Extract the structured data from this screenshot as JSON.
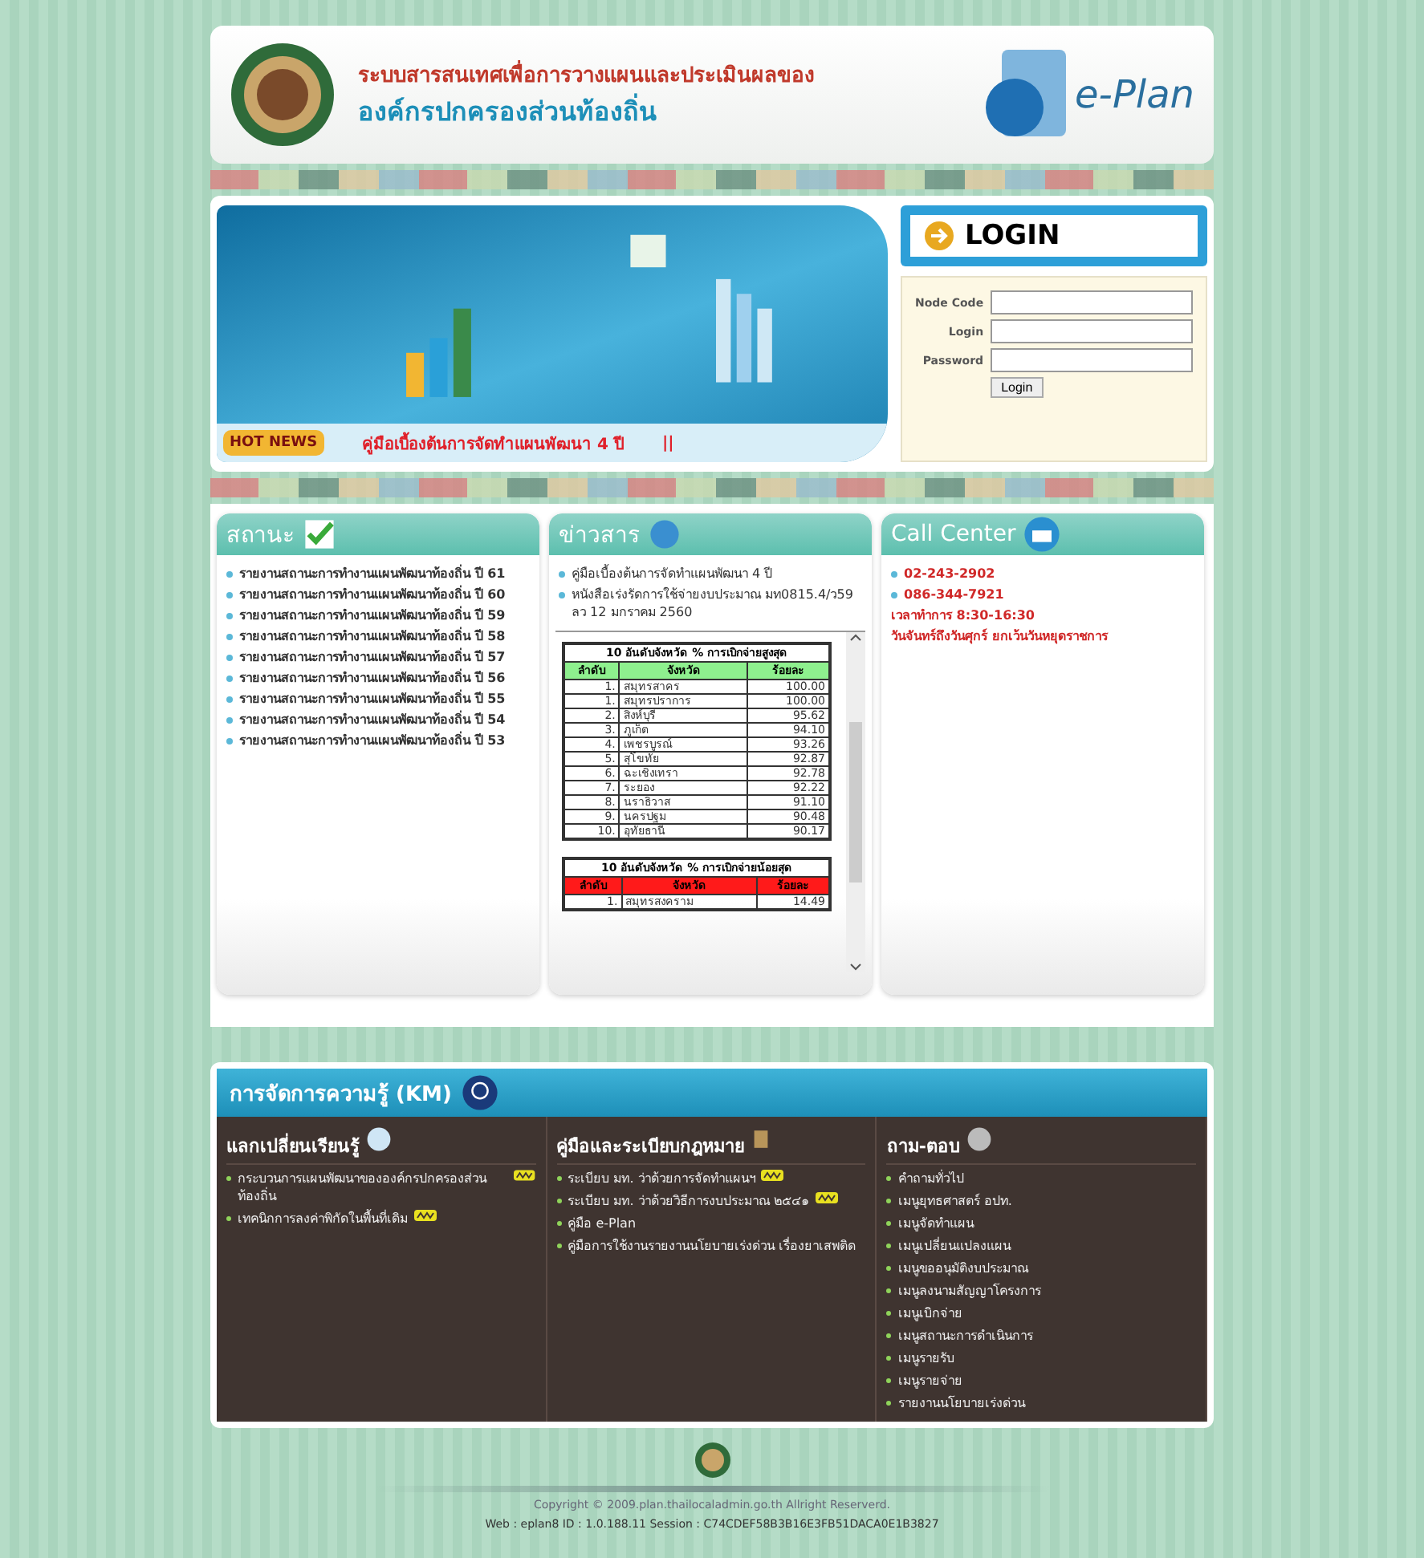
{
  "header": {
    "title_line1": "ระบบสารสนเทศเพื่อการวางแผนและประเมินผลของ",
    "title_line2": "องค์กรปกครองส่วนท้องถิ่น",
    "logo_text": "e-Plan"
  },
  "hot_news": {
    "badge": "HOT NEWS",
    "text": "คู่มือเบื้องต้นการจัดทำแผนพัฒนา 4 ปี",
    "separator": "||"
  },
  "login": {
    "title": "LOGIN",
    "fields": [
      {
        "label": "Node Code"
      },
      {
        "label": "Login"
      },
      {
        "label": "Password"
      }
    ],
    "button": "Login"
  },
  "status_panel": {
    "title": "สถานะ",
    "items": [
      {
        "text": "รายงานสถานะการทำงานแผนพัฒนาท้องถิ่น ปี 61"
      },
      {
        "text": "รายงานสถานะการทำงานแผนพัฒนาท้องถิ่น ปี 60"
      },
      {
        "text": "รายงานสถานะการทำงานแผนพัฒนาท้องถิ่น ปี 59"
      },
      {
        "text": "รายงานสถานะการทำงานแผนพัฒนาท้องถิ่น ปี 58"
      },
      {
        "text": "รายงานสถานะการทำงานแผนพัฒนาท้องถิ่น ปี 57"
      },
      {
        "text": "รายงานสถานะการทำงานแผนพัฒนาท้องถิ่น ปี 56"
      },
      {
        "text": "รายงานสถานะการทำงานแผนพัฒนาท้องถิ่น ปี 55"
      },
      {
        "text": "รายงานสถานะการทำงานแผนพัฒนาท้องถิ่น ปี 54"
      },
      {
        "text": "รายงานสถานะการทำงานแผนพัฒนาท้องถิ่น ปี 53"
      }
    ]
  },
  "news_panel": {
    "title": "ข่าวสาร",
    "items": [
      {
        "text": "คู่มือเบื้องต้นการจัดทำแผนพัฒนา 4 ปี"
      },
      {
        "text": "หนังสือเร่งรัดการใช้จ่ายงบประมาณ มท0815.4/ว59 ลว 12 มกราคม 2560"
      }
    ],
    "tables": [
      {
        "kind": "top",
        "title": "10 อันดับจังหวัด % การเบิกจ่ายสูงสุด",
        "columns": [
          "ลำดับ",
          "จังหวัด",
          "ร้อยละ"
        ],
        "rows": [
          [
            "1.",
            "สมุทรสาคร",
            "100.00"
          ],
          [
            "1.",
            "สมุทรปราการ",
            "100.00"
          ],
          [
            "2.",
            "สิงห์บุรี",
            "95.62"
          ],
          [
            "3.",
            "ภูเก็ต",
            "94.10"
          ],
          [
            "4.",
            "เพชรบูรณ์",
            "93.26"
          ],
          [
            "5.",
            "สุโขทัย",
            "92.87"
          ],
          [
            "6.",
            "ฉะเชิงเทรา",
            "92.78"
          ],
          [
            "7.",
            "ระยอง",
            "92.22"
          ],
          [
            "8.",
            "นราธิวาส",
            "91.10"
          ],
          [
            "9.",
            "นครปฐม",
            "90.48"
          ],
          [
            "10.",
            "อุทัยธานี",
            "90.17"
          ]
        ]
      },
      {
        "kind": "bottom",
        "title": "10 อันดับจังหวัด % การเบิกจ่ายน้อยสุด",
        "columns": [
          "ลำดับ",
          "จังหวัด",
          "ร้อยละ"
        ],
        "rows": [
          [
            "1.",
            "สมุทรสงคราม",
            "14.49"
          ]
        ]
      }
    ]
  },
  "call_center": {
    "title": "Call Center",
    "phones": [
      "02-243-2902",
      "086-344-7921"
    ],
    "hours": "เวลาทำการ 8:30-16:30",
    "days": "วันจันทร์ถึงวันศุกร์ ยกเว้นวันหยุดราชการ"
  },
  "km": {
    "title": "การจัดการความรู้ (KM)",
    "sections": [
      {
        "kind": "exchange",
        "title": "แลกเปลี่ยนเรียนรู้",
        "items": [
          {
            "text": "กระบวนการแผนพัฒนาขององค์กรปกครองส่วนท้องถิ่น",
            "is_new": true
          },
          {
            "text": "เทคนิกการลงค่าพิกัดในพื้นที่เดิม",
            "is_new": true
          }
        ]
      },
      {
        "kind": "manual",
        "title": "คู่มือและระเบียบกฎหมาย",
        "items": [
          {
            "text": "ระเบียบ มท. ว่าด้วยการจัดทำแผนฯ",
            "is_new": true
          },
          {
            "text": "ระเบียบ มท. ว่าด้วยวิธีการงบประมาณ ๒๕๔๑",
            "is_new": true
          },
          {
            "text": "คู่มือ e-Plan",
            "is_new": false
          },
          {
            "text": "คู่มือการใช้งานรายงานนโยบายเร่งด่วน เรื่องยาเสพติด",
            "is_new": false
          }
        ]
      },
      {
        "kind": "faq",
        "title": "ถาม-ตอบ",
        "items": [
          {
            "text": "คำถามทั่วไป",
            "is_new": false
          },
          {
            "text": "เมนูยุทธศาสตร์ อปท.",
            "is_new": false
          },
          {
            "text": "เมนูจัดทำแผน",
            "is_new": false
          },
          {
            "text": "เมนูเปลี่ยนแปลงแผน",
            "is_new": false
          },
          {
            "text": "เมนูขออนุมัติงบประมาณ",
            "is_new": false
          },
          {
            "text": "เมนูลงนามสัญญาโครงการ",
            "is_new": false
          },
          {
            "text": "เมนูเบิกจ่าย",
            "is_new": false
          },
          {
            "text": "เมนูสถานะการดำเนินการ",
            "is_new": false
          },
          {
            "text": "เมนูรายรับ",
            "is_new": false
          },
          {
            "text": "เมนูรายจ่าย",
            "is_new": false
          },
          {
            "text": "รายงานนโยบายเร่งด่วน",
            "is_new": false
          }
        ]
      }
    ]
  },
  "footer": {
    "copyright": "Copyright © 2009.plan.thailocaladmin.go.th Allright Reserverd.",
    "session": "Web : eplan8  ID : 1.0.188.11  Session : C74CDEF58B3B16E3FB51DACA0E1B3827"
  }
}
